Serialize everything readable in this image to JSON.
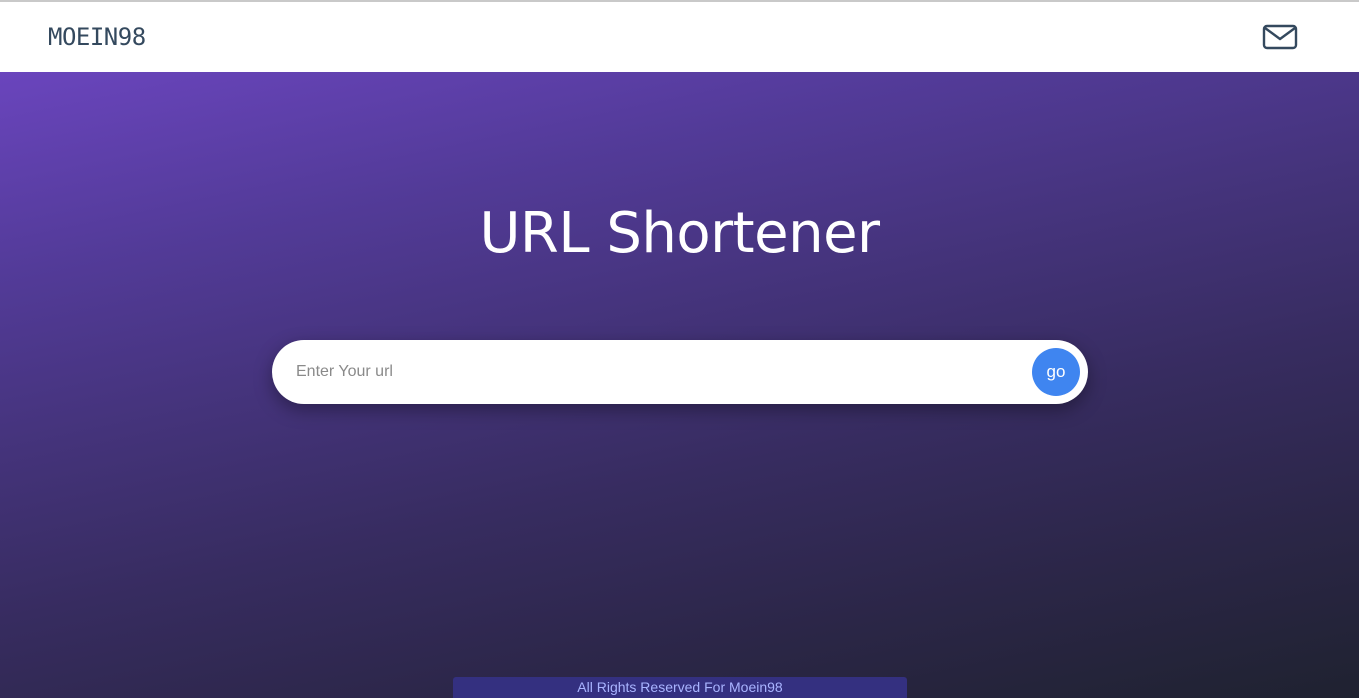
{
  "navbar": {
    "brand": "MOEIN98",
    "contact_icon": "envelope-icon"
  },
  "hero": {
    "title": "URL Shortener",
    "input": {
      "value": "",
      "placeholder": "Enter Your url"
    },
    "submit_label": "go"
  },
  "footer": {
    "text": "All Rights Reserved For Moein98"
  },
  "colors": {
    "gradient_start": "#6a45bd",
    "gradient_end": "#1f2230",
    "button": "#3f85f0",
    "brand_text": "#34495e",
    "footer_bg": "#343080",
    "footer_text": "#a9b4ff"
  }
}
